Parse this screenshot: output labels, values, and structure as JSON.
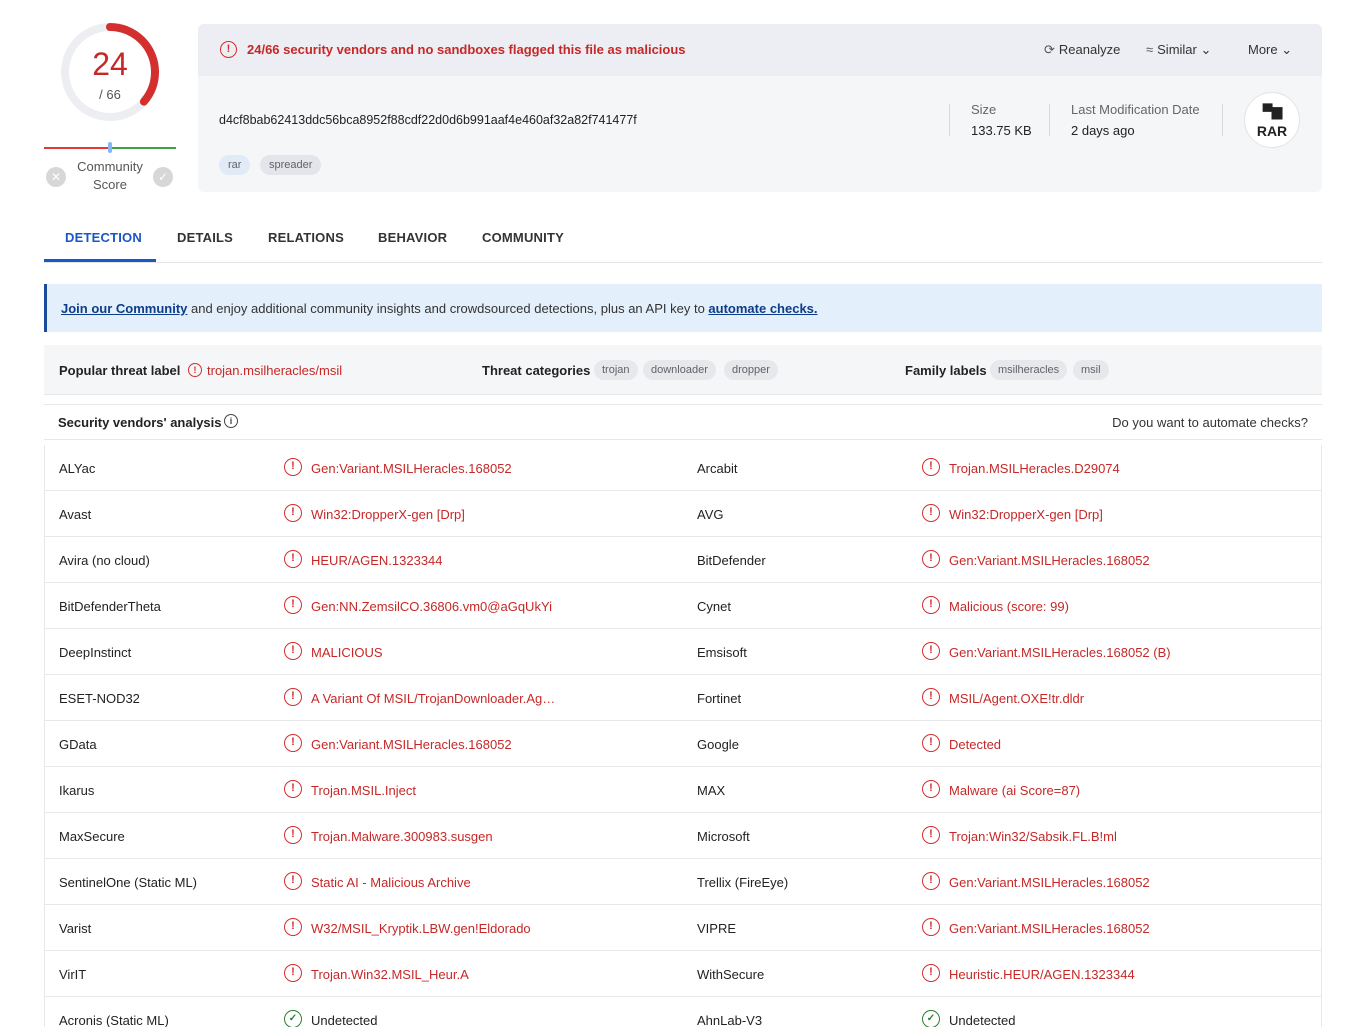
{
  "score": {
    "detected": "24",
    "total": "/ 66",
    "detected_fraction": 0.3636,
    "community_label": "Community Score"
  },
  "header": {
    "alert_text": "24/66 security vendors and no sandboxes flagged this file as malicious",
    "actions": {
      "reanalyze": "Reanalyze",
      "similar": "Similar",
      "more": "More"
    },
    "hash": "d4cf8bab62413ddc56bca8952f88cdf22d0d6b991aaf4e460af32a82f741477f",
    "tags": [
      "rar",
      "spreader"
    ],
    "size_label": "Size",
    "size_value": "133.75 KB",
    "lastmod_label": "Last Modification Date",
    "lastmod_value": "2 days ago",
    "file_type": "RAR"
  },
  "tabs": [
    "DETECTION",
    "DETAILS",
    "RELATIONS",
    "BEHAVIOR",
    "COMMUNITY"
  ],
  "banner": {
    "link1": "Join our Community",
    "middle": " and enjoy additional community insights and crowdsourced detections, plus an API key to ",
    "link2": "automate checks."
  },
  "threat": {
    "popular_label": "Popular threat label",
    "popular_value": "trojan.msilheracles/msil",
    "categories_label": "Threat categories",
    "categories": [
      "trojan",
      "downloader",
      "dropper"
    ],
    "family_label": "Family labels",
    "families": [
      "msilheracles",
      "msil"
    ]
  },
  "vendors_header": {
    "title": "Security vendors' analysis",
    "right": "Do you want to automate checks?"
  },
  "vendors": [
    {
      "left": {
        "name": "ALYac",
        "result": "Gen:Variant.MSILHeracles.168052",
        "status": "bad"
      },
      "right": {
        "name": "Arcabit",
        "result": "Trojan.MSILHeracles.D29074",
        "status": "bad"
      }
    },
    {
      "left": {
        "name": "Avast",
        "result": "Win32:DropperX-gen [Drp]",
        "status": "bad"
      },
      "right": {
        "name": "AVG",
        "result": "Win32:DropperX-gen [Drp]",
        "status": "bad"
      }
    },
    {
      "left": {
        "name": "Avira (no cloud)",
        "result": "HEUR/AGEN.1323344",
        "status": "bad"
      },
      "right": {
        "name": "BitDefender",
        "result": "Gen:Variant.MSILHeracles.168052",
        "status": "bad"
      }
    },
    {
      "left": {
        "name": "BitDefenderTheta",
        "result": "Gen:NN.ZemsilCO.36806.vm0@aGqUkYi",
        "status": "bad"
      },
      "right": {
        "name": "Cynet",
        "result": "Malicious (score: 99)",
        "status": "bad"
      }
    },
    {
      "left": {
        "name": "DeepInstinct",
        "result": "MALICIOUS",
        "status": "bad"
      },
      "right": {
        "name": "Emsisoft",
        "result": "Gen:Variant.MSILHeracles.168052 (B)",
        "status": "bad"
      }
    },
    {
      "left": {
        "name": "ESET-NOD32",
        "result": "A Variant Of MSIL/TrojanDownloader.Ag…",
        "status": "bad"
      },
      "right": {
        "name": "Fortinet",
        "result": "MSIL/Agent.OXE!tr.dldr",
        "status": "bad"
      }
    },
    {
      "left": {
        "name": "GData",
        "result": "Gen:Variant.MSILHeracles.168052",
        "status": "bad"
      },
      "right": {
        "name": "Google",
        "result": "Detected",
        "status": "bad"
      }
    },
    {
      "left": {
        "name": "Ikarus",
        "result": "Trojan.MSIL.Inject",
        "status": "bad"
      },
      "right": {
        "name": "MAX",
        "result": "Malware (ai Score=87)",
        "status": "bad"
      }
    },
    {
      "left": {
        "name": "MaxSecure",
        "result": "Trojan.Malware.300983.susgen",
        "status": "bad"
      },
      "right": {
        "name": "Microsoft",
        "result": "Trojan:Win32/Sabsik.FL.B!ml",
        "status": "bad"
      }
    },
    {
      "left": {
        "name": "SentinelOne (Static ML)",
        "result": "Static AI - Malicious Archive",
        "status": "bad"
      },
      "right": {
        "name": "Trellix (FireEye)",
        "result": "Gen:Variant.MSILHeracles.168052",
        "status": "bad"
      }
    },
    {
      "left": {
        "name": "Varist",
        "result": "W32/MSIL_Kryptik.LBW.gen!Eldorado",
        "status": "bad"
      },
      "right": {
        "name": "VIPRE",
        "result": "Gen:Variant.MSILHeracles.168052",
        "status": "bad"
      }
    },
    {
      "left": {
        "name": "VirIT",
        "result": "Trojan.Win32.MSIL_Heur.A",
        "status": "bad"
      },
      "right": {
        "name": "WithSecure",
        "result": "Heuristic.HEUR/AGEN.1323344",
        "status": "bad"
      }
    },
    {
      "left": {
        "name": "Acronis (Static ML)",
        "result": "Undetected",
        "status": "ok"
      },
      "right": {
        "name": "AhnLab-V3",
        "result": "Undetected",
        "status": "ok"
      }
    }
  ]
}
